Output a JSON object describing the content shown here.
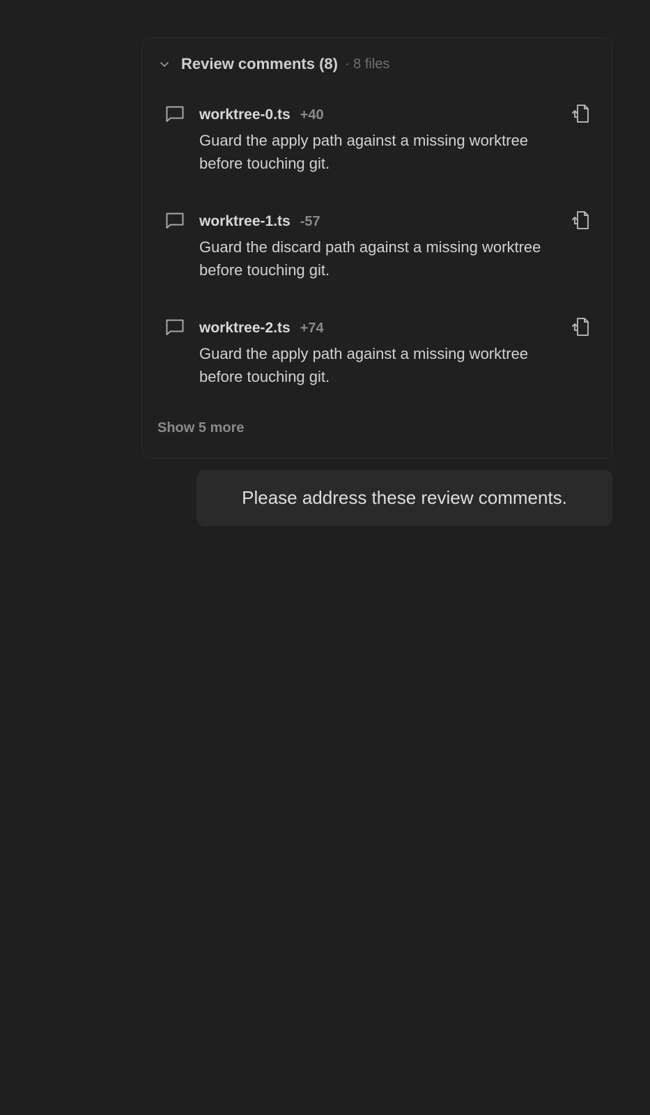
{
  "review_panel": {
    "title": "Review comments (8)",
    "meta": "· 8 files",
    "show_more_label": "Show 5 more",
    "comments": [
      {
        "filename": "worktree-0.ts",
        "delta": "+40",
        "body": "Guard the apply path against a missing worktree before touching git."
      },
      {
        "filename": "worktree-1.ts",
        "delta": "-57",
        "body": "Guard the discard path against a missing worktree before touching git."
      },
      {
        "filename": "worktree-2.ts",
        "delta": "+74",
        "body": "Guard the apply path against a missing worktree before touching git."
      }
    ]
  },
  "message": {
    "text": "Please address these review comments."
  },
  "icons": {
    "collapse": "chevron-down-icon",
    "comment": "comment-icon",
    "open_file": "open-file-icon"
  },
  "colors": {
    "background": "#1f1f1f",
    "card_border": "#2c2c2c",
    "bubble": "#2a2a2a",
    "muted_text": "#8a8a8a"
  }
}
